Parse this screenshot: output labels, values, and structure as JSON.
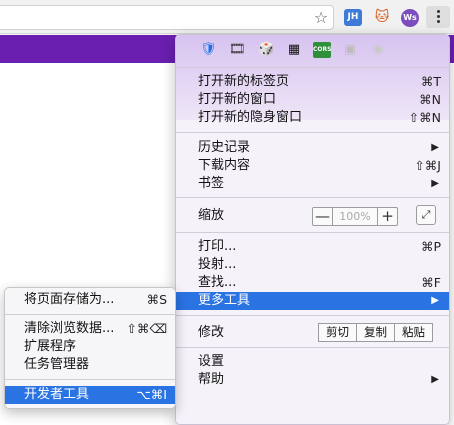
{
  "toolbar": {
    "star_icon": "☆",
    "extensions": [
      {
        "name": "jh-extension-icon",
        "text": "JH"
      },
      {
        "name": "cat-extension-icon",
        "text": "🐱"
      },
      {
        "name": "ws-extension-icon",
        "text": "Ws"
      }
    ]
  },
  "menu": {
    "extension_icons": [
      "🛡",
      "🎞",
      "🎲",
      "▦",
      "CORS",
      "▣",
      "◉"
    ],
    "new_tab": {
      "label": "打开新的标签页",
      "shortcut": "⌘T"
    },
    "new_window": {
      "label": "打开新的窗口",
      "shortcut": "⌘N"
    },
    "new_incognito": {
      "label": "打开新的隐身窗口",
      "shortcut": "⇧⌘N"
    },
    "history": {
      "label": "历史记录"
    },
    "downloads": {
      "label": "下载内容",
      "shortcut": "⇧⌘J"
    },
    "bookmarks": {
      "label": "书签"
    },
    "zoom": {
      "label": "缩放",
      "minus": "—",
      "value": "100%",
      "plus": "+",
      "fullscreen": "⤢"
    },
    "print": {
      "label": "打印...",
      "shortcut": "⌘P"
    },
    "cast": {
      "label": "投射..."
    },
    "find": {
      "label": "查找...",
      "shortcut": "⌘F"
    },
    "more_tools": {
      "label": "更多工具"
    },
    "edit": {
      "label": "修改",
      "cut": "剪切",
      "copy": "复制",
      "paste": "粘贴"
    },
    "settings": {
      "label": "设置"
    },
    "help": {
      "label": "帮助"
    }
  },
  "submenu": {
    "save_page": {
      "label": "将页面存储为...",
      "shortcut": "⌘S"
    },
    "clear_data": {
      "label": "清除浏览数据...",
      "shortcut": "⇧⌘⌫"
    },
    "extensions": {
      "label": "扩展程序"
    },
    "task_manager": {
      "label": "任务管理器"
    },
    "developer_tools": {
      "label": "开发者工具",
      "shortcut": "⌥⌘I"
    }
  },
  "colors": {
    "highlight": "#2a73e3",
    "banner": "#6a1fb0"
  }
}
